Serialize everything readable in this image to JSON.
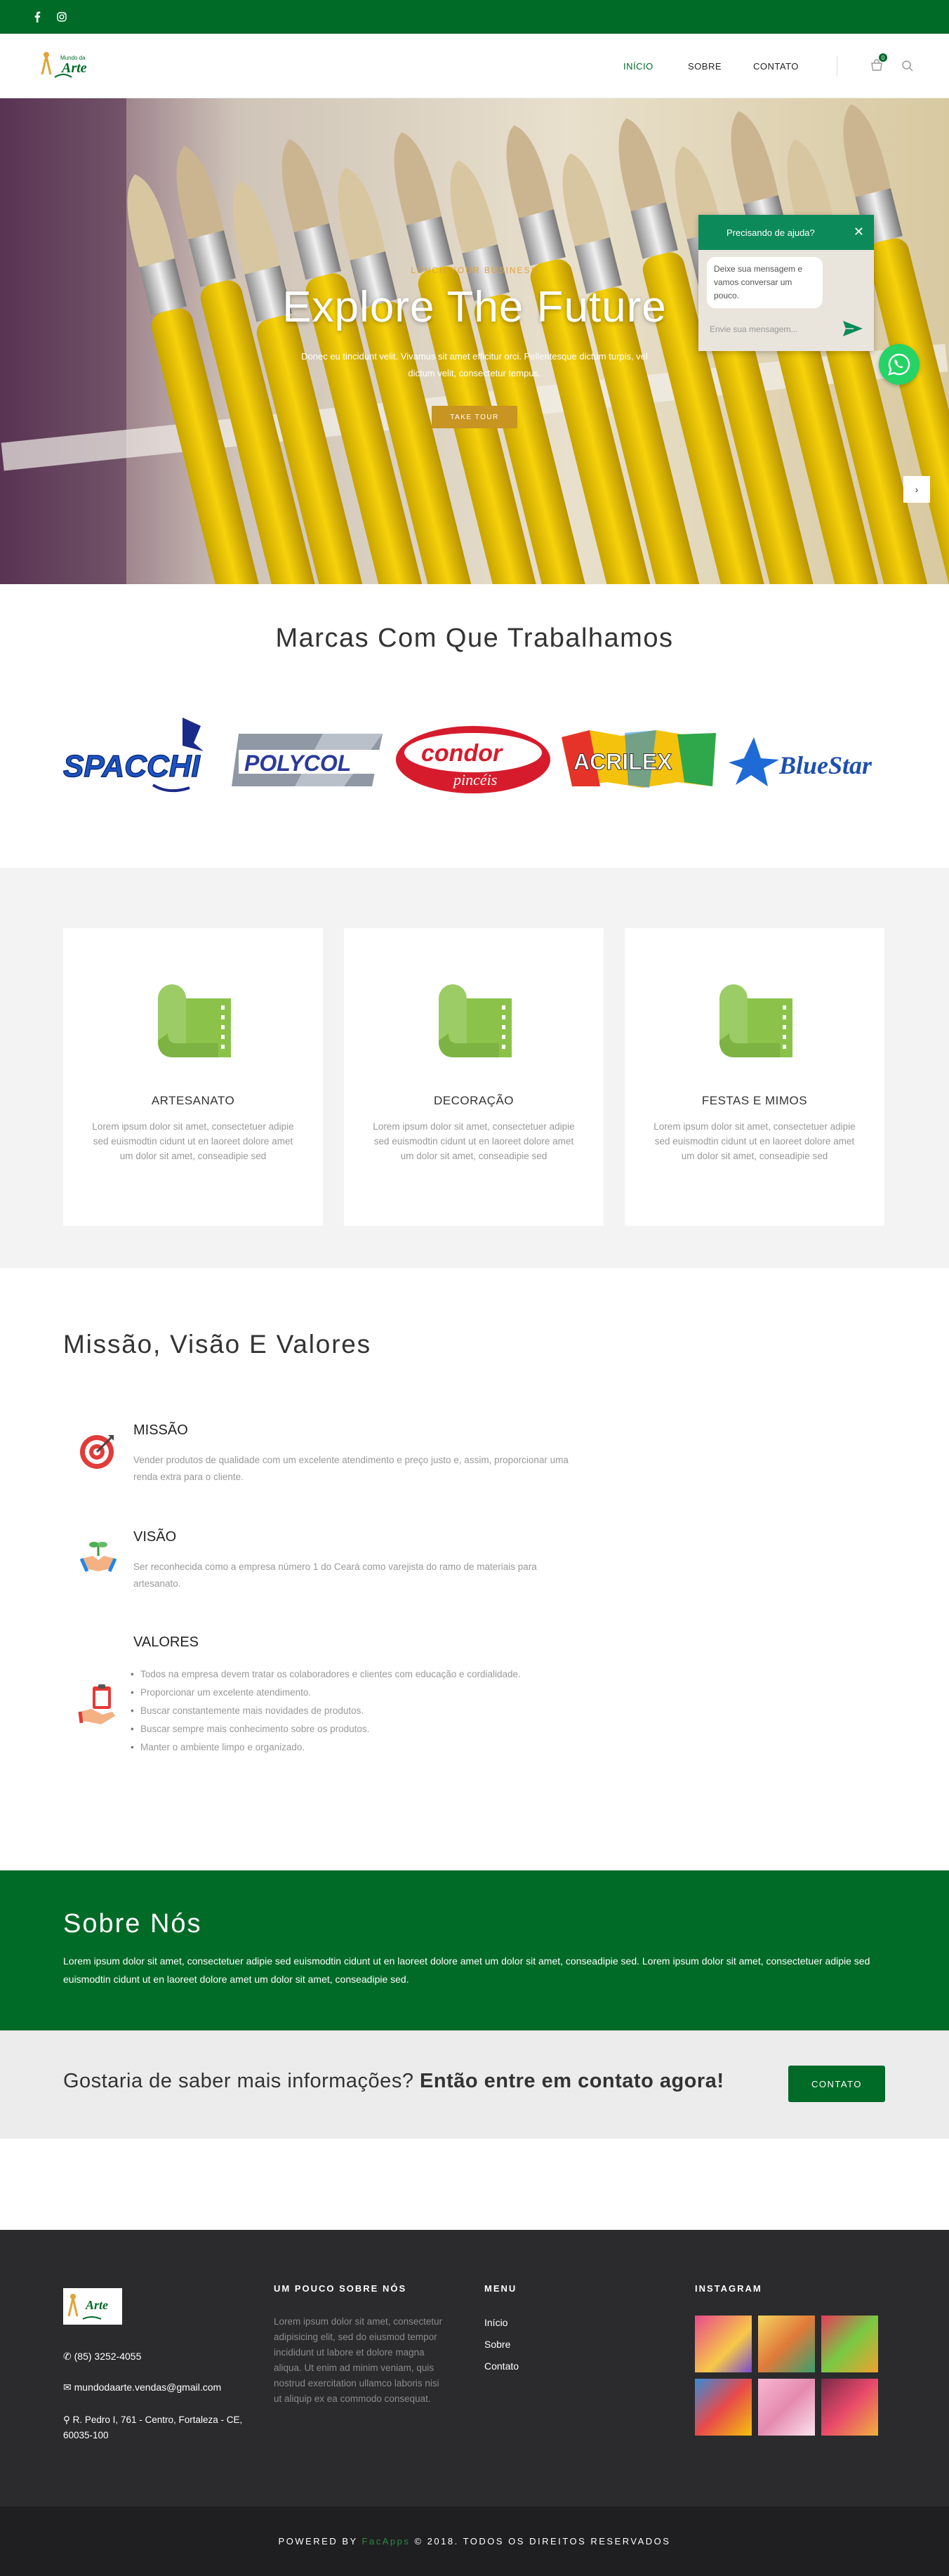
{
  "topbar": {
    "icons": [
      "facebook-icon",
      "instagram-icon"
    ]
  },
  "nav": {
    "logo_text": "Arte",
    "logo_small": "Mundo da",
    "links": [
      "INÍCIO",
      "SOBRE",
      "CONTATO"
    ],
    "cart_badge": "0",
    "accent": "#006a27"
  },
  "hero": {
    "subtitle": "LUNCH YOUR BUSINESS",
    "title": "Explore The Future",
    "text": "Donec eu tincidunt velit. Vivamus sit amet efficitur orci. Pellentesque dictum turpis, vel dictum velit, consectetur tempus.",
    "button": "TAKE TOUR"
  },
  "chat": {
    "title": "Precisando de ajuda?",
    "message": "Deixe sua mensagem e vamos conversar um pouco.",
    "placeholder": "Envie sua mensagem..."
  },
  "brands": {
    "title": "Marcas Com Que Trabalhamos",
    "items": [
      "SPACCHI",
      "POLYCOL",
      "condor",
      "pincéis",
      "ACRILEX",
      "BlueStar"
    ]
  },
  "services": [
    {
      "title": "ARTESANATO",
      "text": "Lorem ipsum dolor sit amet, consectetuer adipie  sed euismodtin cidunt ut en laoreet dolore amet um dolor sit amet, conseadipie  sed"
    },
    {
      "title": "DECORAÇÃO",
      "text": "Lorem ipsum dolor sit amet, consectetuer adipie  sed euismodtin cidunt ut en laoreet dolore amet um dolor sit amet, conseadipie  sed"
    },
    {
      "title": "FESTAS E MIMOS",
      "text": "Lorem ipsum dolor sit amet, consectetuer adipie  sed euismodtin cidunt ut en laoreet dolore amet um dolor sit amet, conseadipie  sed"
    }
  ],
  "mission": {
    "title": "Missão, Visão E Valores",
    "missao": {
      "head": "MISSÃO",
      "text": "Vender produtos de qualidade com um excelente atendimento e preço justo e, assim, proporcionar uma renda extra para o cliente."
    },
    "visao": {
      "head": "VISÃO",
      "text": "Ser reconhecida como a empresa número 1 do Ceará como varejista do ramo de materiais para artesanato."
    },
    "valores": {
      "head": "VALORES",
      "items": [
        "Todos na empresa devem tratar os colaboradores e clientes com educação e cordialidade.",
        "Proporcionar um excelente atendimento.",
        "Buscar constantemente mais novidades de produtos.",
        "Buscar sempre mais conhecimento sobre os produtos.",
        "Manter o ambiente limpo e organizado."
      ]
    }
  },
  "about": {
    "title": "Sobre Nós",
    "text": "Lorem ipsum dolor sit amet, consectetuer adipie  sed euismodtin cidunt ut en laoreet dolore amet um dolor sit amet, conseadipie  sed. Lorem ipsum dolor sit amet, consectetuer adipie  sed euismodtin cidunt ut en laoreet dolore amet um dolor sit amet, conseadipie  sed."
  },
  "cta": {
    "text_light": "Gostaria de saber mais informações?",
    "text_bold": "Então entre em contato agora!",
    "button": "CONTATO"
  },
  "footer": {
    "phone": "(85) 3252-4055",
    "email": "mundodaarte.vendas@gmail.com",
    "address": "R. Pedro I, 761 - Centro, Fortaleza - CE, 60035-100",
    "about_head": "UM POUCO SOBRE NÓS",
    "about_text": "Lorem ipsum dolor sit amet, consectetur adipisicing elit, sed do eiusmod tempor incididunt ut labore et dolore magna aliqua. Ut enim ad minim veniam, quis nostrud exercitation ullamco laboris nisi ut aliquip ex ea commodo consequat.",
    "menu_head": "MENU",
    "menu": [
      "Início",
      "Sobre",
      "Contato"
    ],
    "instagram_head": "INSTAGRAM",
    "copyright_pre": "POWERED BY",
    "copyright_brand": "FacApps",
    "copyright_post": "© 2018. TODOS OS DIREITOS RESERVADOS"
  }
}
